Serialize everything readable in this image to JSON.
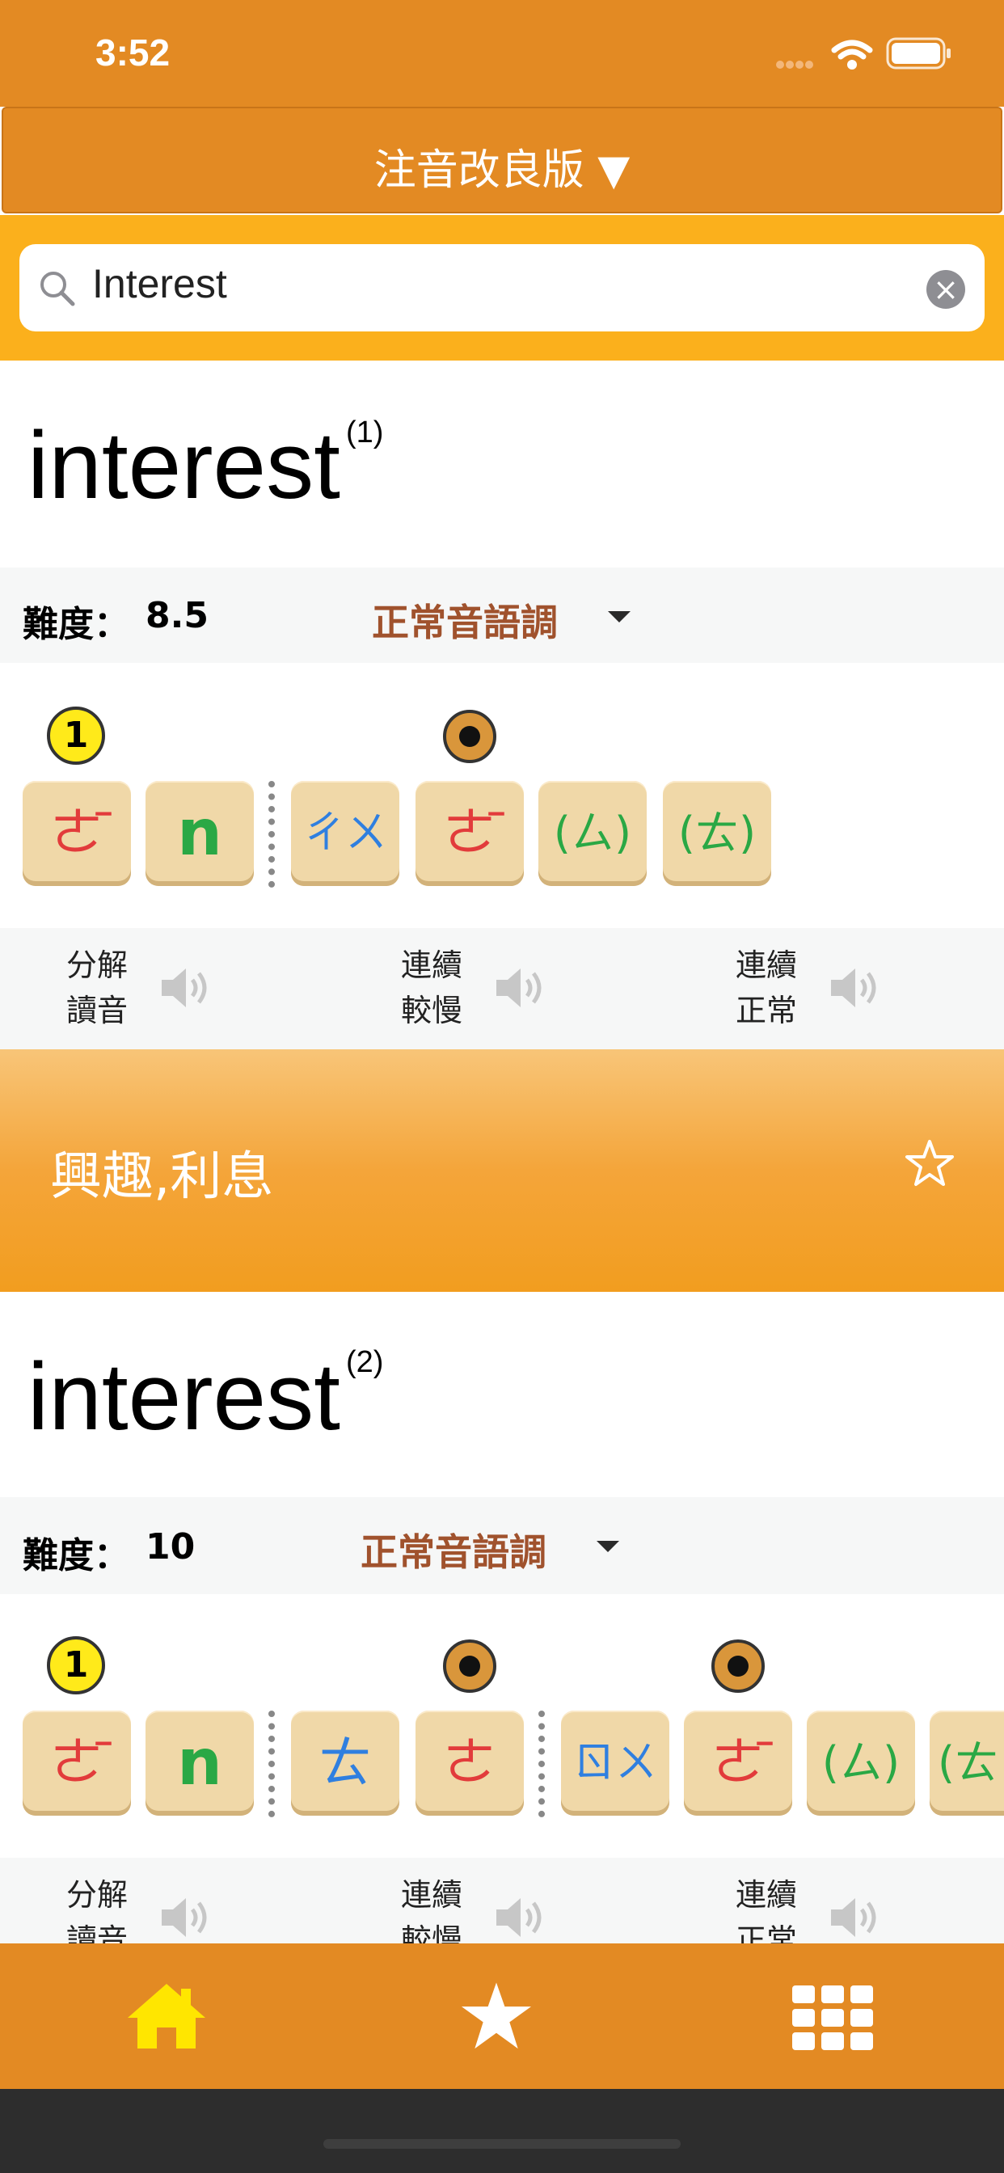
{
  "status_bar": {
    "time": "3:52"
  },
  "header": {
    "title": "注音改良版 ▼"
  },
  "search": {
    "value": "Interest"
  },
  "entries": [
    {
      "word": "interest",
      "index": "(1)",
      "difficulty_label": "難度：",
      "difficulty": "8.5",
      "tone_label": "正常音語調",
      "marks": {
        "yellow": "1"
      },
      "tiles": [
        {
          "glyph": "ㄜ̄",
          "color": "#e23b3b"
        },
        {
          "glyph": "n",
          "color": "#2aa845"
        },
        {
          "glyph": "ㄔㄨ",
          "color": "#2f7fe0"
        },
        {
          "glyph": "ㄜ̄",
          "color": "#e23b3b"
        },
        {
          "glyph": "(ㄙ)",
          "color": "#2aa845"
        },
        {
          "glyph": "(ㄊ)",
          "color": "#2aa845"
        }
      ],
      "audio": [
        {
          "line1": "分解",
          "line2": "讀音"
        },
        {
          "line1": "連續",
          "line2": "較慢"
        },
        {
          "line1": "連續",
          "line2": "正常"
        }
      ],
      "meaning": "興趣,利息"
    },
    {
      "word": "interest",
      "index": "(2)",
      "difficulty_label": "難度：",
      "difficulty": "10",
      "tone_label": "正常音語調",
      "marks": {
        "yellow": "1"
      },
      "tiles": [
        {
          "glyph": "ㄜ̄",
          "color": "#e23b3b"
        },
        {
          "glyph": "n",
          "color": "#2aa845"
        },
        {
          "glyph": "ㄊ",
          "color": "#2f7fe0"
        },
        {
          "glyph": "ㄜ",
          "color": "#e23b3b"
        },
        {
          "glyph": "ㄖㄨ",
          "color": "#2f7fe0"
        },
        {
          "glyph": "ㄜ̄",
          "color": "#e23b3b"
        },
        {
          "glyph": "(ㄙ)",
          "color": "#2aa845"
        },
        {
          "glyph": "(ㄊ",
          "color": "#2aa845"
        }
      ],
      "audio": [
        {
          "line1": "分解",
          "line2": "讀音"
        },
        {
          "line1": "連續",
          "line2": "較慢"
        },
        {
          "line1": "連續",
          "line2": "正常"
        }
      ]
    }
  ],
  "tab_bar": {
    "home_icon": "home-icon",
    "favorites_icon": "star-icon",
    "menu_icon": "grid-icon"
  },
  "colors": {
    "primary": "#e38a23",
    "search_band": "#fbb01c",
    "tone": "#a0522d",
    "home_yellow": "#ffe600"
  }
}
